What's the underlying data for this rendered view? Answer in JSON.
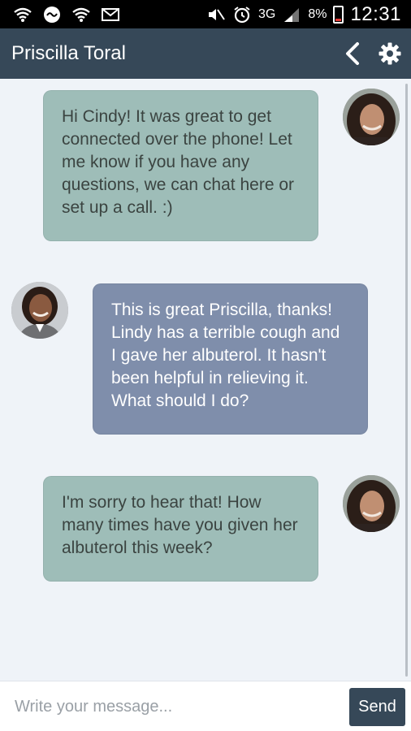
{
  "status_bar": {
    "icons_left": [
      "wifi-icon",
      "sync-icon",
      "wifi-icon",
      "mail-icon"
    ],
    "icons_right": [
      "mute-icon",
      "alarm-icon",
      "signal-icon",
      "battery-icon"
    ],
    "network": "3G",
    "battery": "8%",
    "time": "12:31"
  },
  "header": {
    "title": "Priscilla Toral",
    "back_icon": "chevron-left-icon",
    "settings_icon": "gear-icon"
  },
  "messages": [
    {
      "sender": "Priscilla Toral",
      "direction": "incoming",
      "text": "Hi Cindy! It was great to get connected over the phone! Let me know if you have any questions, we can chat here or set up a call. :)"
    },
    {
      "sender": "Cindy",
      "direction": "outgoing",
      "text": "This is great Priscilla, thanks! Lindy has a terrible cough and I gave her albuterol. It hasn't been helpful in relieving it. What should I do?"
    },
    {
      "sender": "Priscilla Toral",
      "direction": "incoming",
      "text": "I'm sorry to hear that! How many times have you given her albuterol this week?"
    }
  ],
  "composer": {
    "placeholder": "Write your message...",
    "value": "",
    "send_label": "Send"
  },
  "colors": {
    "header_bg": "#364858",
    "incoming_bubble": "#9ebdb8",
    "outgoing_bubble": "#7f8eab",
    "chat_bg": "#eff3f8"
  }
}
